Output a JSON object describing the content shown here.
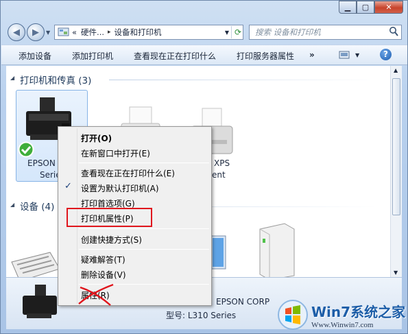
{
  "nav": {
    "breadcrumb_overflow": "«",
    "breadcrumb_1": "硬件...",
    "breadcrumb_2": "设备和打印机",
    "breadcrumb_sep": "▸",
    "search_placeholder": "搜索 设备和打印机"
  },
  "toolbar": {
    "items": [
      "添加设备",
      "添加打印机",
      "查看现在正在打印什么",
      "打印服务器属性"
    ],
    "overflow": "»"
  },
  "groups": {
    "printers": "打印机和传真 (3)",
    "devices": "设备 (4)"
  },
  "items": {
    "epson_name_1": "EPSON",
    "epson_name_2": "Serie",
    "xps_name_1": "XPS",
    "xps_name_2": "ent"
  },
  "menu": {
    "open": "打开(O)",
    "open_new_window": "在新窗口中打开(E)",
    "see_printing": "查看现在正在打印什么(E)",
    "set_default": "设置为默认打印机(A)",
    "print_prefs": "打印首选项(G)",
    "printer_props": "打印机属性(P)",
    "create_shortcut": "创建快捷方式(S)",
    "troubleshoot": "疑难解答(T)",
    "remove_device": "删除设备(V)",
    "properties": "属性(R)"
  },
  "details": {
    "manufacturer_partial": "EPSON CORP",
    "model": "型号: L310 Series"
  },
  "watermark": {
    "logo": "Win7系统之家",
    "url": "Www.Winwin7.com"
  },
  "colors": {
    "highlight_box": "#e0151c",
    "window_frame": "#b9d1ee"
  }
}
